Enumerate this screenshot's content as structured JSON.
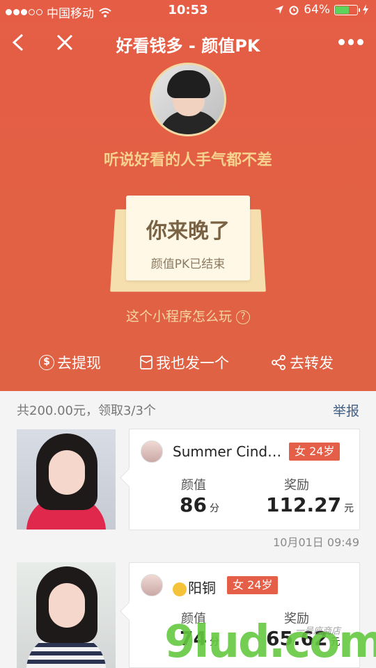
{
  "status_bar": {
    "carrier": "中国移动",
    "time": "10:53",
    "battery_text": "64%",
    "battery_level": 0.64
  },
  "nav": {
    "title": "好看钱多 - 颜值PK"
  },
  "hero": {
    "slogan": "听说好看的人手气都不差",
    "card_title": "你来晚了",
    "card_subtitle": "颜值PK已结束",
    "howto": "这个小程序怎么玩",
    "howto_icon": "?"
  },
  "actions": [
    {
      "label": "去提现",
      "icon": "$"
    },
    {
      "label": "我也发一个",
      "icon": "envelope-icon"
    },
    {
      "label": "去转发",
      "icon": "share-icon"
    }
  ],
  "summary": {
    "text": "共200.00元，领取3/3个",
    "report": "举报"
  },
  "entries": [
    {
      "name": "Summer Cind…",
      "tag": "女 24岁",
      "score_label": "颜值",
      "score": "86",
      "score_unit": "分",
      "reward_label": "奖励",
      "reward": "112.27",
      "reward_unit": "元",
      "timestamp": "10月01日 09:49"
    },
    {
      "name": "阳铜",
      "tag": "女 24岁",
      "score_label": "颜值",
      "score": "74",
      "score_unit": "分",
      "reward_label": "奖励",
      "reward": "65.62",
      "reward_unit": "元"
    }
  ],
  "watermark": {
    "text": "9lud.com",
    "small": "一号座商店"
  }
}
